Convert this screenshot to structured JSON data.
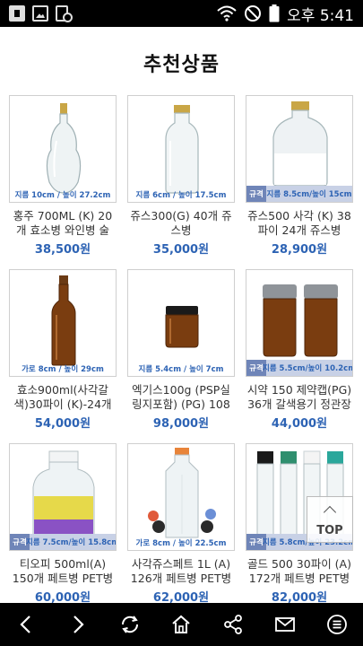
{
  "status_bar": {
    "left_icons": [
      "app-notification-icon",
      "image-icon",
      "device-sync-icon"
    ],
    "right_icons": [
      "wifi-icon",
      "do-not-disturb-icon",
      "battery-icon"
    ],
    "clock": "오후 5:41"
  },
  "page": {
    "title": "추천상품"
  },
  "products": [
    {
      "name": "홍주 700ML (K) 20개 효소병 와인병 술",
      "price": "38,500원",
      "dims": "지름 10cm / 높이 27.2cm",
      "spec_tag": ""
    },
    {
      "name": "쥬스300(G) 40개 쥬스병",
      "price": "35,000원",
      "dims": "지름 6cm / 높이 17.5cm",
      "spec_tag": ""
    },
    {
      "name": "쥬스500 사각 (K) 38파이 24개 쥬스병",
      "price": "28,900원",
      "dims": "지름 8.5cm/높이 15cm",
      "spec_tag": "규격"
    },
    {
      "name": "효소900ml(사각갈색)30파이 (K)-24개",
      "price": "54,000원",
      "dims": "가로 8cm / 높이 29cm",
      "spec_tag": ""
    },
    {
      "name": "엑기스100g (PSP실링지포함) (PG) 108",
      "price": "98,000원",
      "dims": "지름 5.4cm / 높이 7cm",
      "spec_tag": ""
    },
    {
      "name": "시약 150 제약캡(PG) 36개 갈색용기 정관장",
      "price": "44,000원",
      "dims": "지름 5.5cm/높이 10.2cm",
      "spec_tag": "규격"
    },
    {
      "name": "티오피 500ml(A) 150개 페트병 PET병",
      "price": "60,000원",
      "dims": "지름 7.5cm/높이 15.8cm",
      "spec_tag": "규격"
    },
    {
      "name": "사각쥬스페트 1L (A) 126개 페트병 PET병",
      "price": "62,000원",
      "dims": "가로 8cm / 높이 22.5cm",
      "spec_tag": ""
    },
    {
      "name": "골드 500 30파이 (A) 172개 페트병 PET병",
      "price": "82,000원",
      "dims": "지름 5.8cm/높이 23.2cm",
      "spec_tag": "규격"
    }
  ],
  "top_button": {
    "label": "TOP"
  },
  "bottom_nav": [
    "back-arrow-icon",
    "forward-arrow-icon",
    "refresh-icon",
    "home-icon",
    "share-icon",
    "mail-icon",
    "menu-icon"
  ]
}
